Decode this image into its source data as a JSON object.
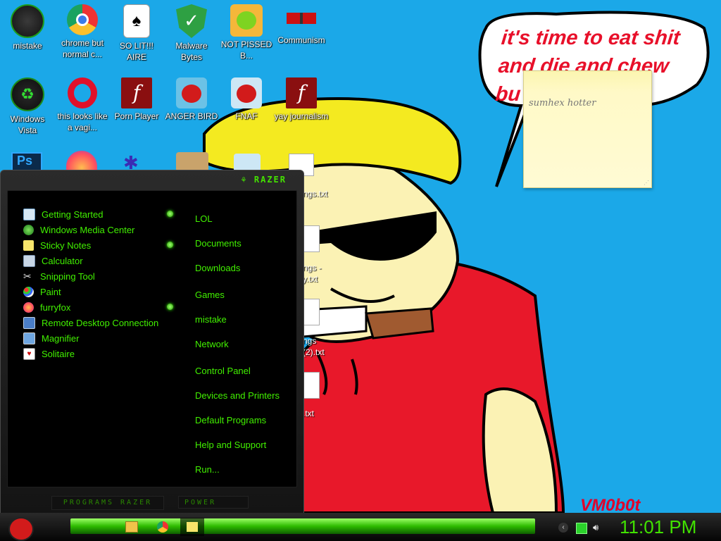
{
  "desktop": {
    "icons": [
      {
        "label": "mistake"
      },
      {
        "label": "chrome but normal c..."
      },
      {
        "label": "SO LIT!!! AIRE"
      },
      {
        "label": "Malware Bytes"
      },
      {
        "label": "NOT PISSED B..."
      },
      {
        "label": "Communism"
      },
      {
        "label": "Windows Vista"
      },
      {
        "label": "this looks like a vagi..."
      },
      {
        "label": "Porn Player"
      },
      {
        "label": "ANGER BIRD"
      },
      {
        "label": "FNAF"
      },
      {
        "label": "yay journalism"
      }
    ],
    "partial_labels": [
      "ngs.txt",
      "ngs - y.txt",
      "ngs (2).txt",
      ".txt"
    ],
    "wallpaper_text": "it's time to eat shit and die and chew bu",
    "signature": "VM0b0t"
  },
  "sticky_note": {
    "text": "sumhex hotter"
  },
  "start_menu": {
    "brand": "RAZER",
    "programs": [
      {
        "label": "Getting Started",
        "has_submenu": true
      },
      {
        "label": "Windows Media Center",
        "has_submenu": false
      },
      {
        "label": "Sticky Notes",
        "has_submenu": true
      },
      {
        "label": "Calculator",
        "has_submenu": false
      },
      {
        "label": "Snipping Tool",
        "has_submenu": false
      },
      {
        "label": "Paint",
        "has_submenu": false
      },
      {
        "label": "furryfox",
        "has_submenu": true
      },
      {
        "label": "Remote Desktop Connection",
        "has_submenu": false
      },
      {
        "label": "Magnifier",
        "has_submenu": false
      },
      {
        "label": "Solitaire",
        "has_submenu": false
      }
    ],
    "links": [
      "LOL",
      "Documents",
      "Downloads",
      "Games",
      "mistake",
      "Network",
      "Control Panel",
      "Devices and Printers",
      "Default Programs",
      "Help and Support",
      "Run..."
    ],
    "programs_button": "PROGRAMS RAZER",
    "power_button": "POWER"
  },
  "taskbar": {
    "clock": "11:01 PM",
    "accent": "#41e200"
  }
}
